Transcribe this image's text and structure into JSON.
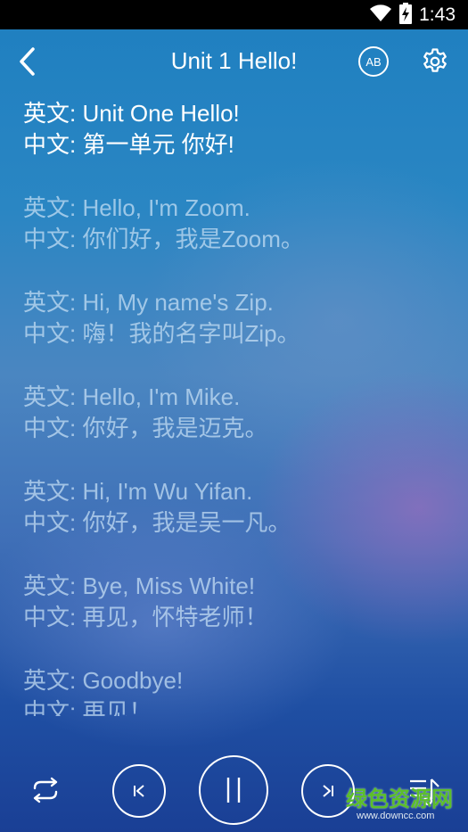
{
  "status_bar": {
    "time": "1:43",
    "icons": [
      "wifi-icon",
      "battery-charging-icon"
    ]
  },
  "header": {
    "title": "Unit 1 Hello!",
    "back_icon": "chevron-left-icon",
    "ab_label": "AB",
    "settings_icon": "gear-icon"
  },
  "lyrics": [
    {
      "en": "英文: Unit One Hello!",
      "zh": "中文: 第一单元 你好!",
      "active": true
    },
    {
      "en": "英文: Hello, I'm Zoom.",
      "zh": "中文: 你们好，我是Zoom。",
      "active": false
    },
    {
      "en": "英文: Hi, My name's Zip.",
      "zh": "中文: 嗨！我的名字叫Zip。",
      "active": false
    },
    {
      "en": "英文: Hello, I'm Mike.",
      "zh": "中文: 你好，我是迈克。",
      "active": false
    },
    {
      "en": "英文: Hi, I'm Wu Yifan.",
      "zh": "中文: 你好，我是吴一凡。",
      "active": false
    },
    {
      "en": "英文: Bye, Miss White!",
      "zh": "中文: 再见，怀特老师！",
      "active": false
    },
    {
      "en": "英文: Goodbye!",
      "zh": "中文: 再见！",
      "active": false
    }
  ],
  "controls": {
    "repeat_icon": "repeat-icon",
    "prev_icon": "skip-previous-icon",
    "pause_icon": "pause-icon",
    "next_icon": "skip-next-icon",
    "playlist_icon": "playlist-icon"
  },
  "watermark": {
    "main": "绿色资源网",
    "sub": "www.downcc.com"
  },
  "colors": {
    "active_text": "#ffffff",
    "inactive_text": "#bcd8f0",
    "watermark_green": "#5cbf2a"
  }
}
